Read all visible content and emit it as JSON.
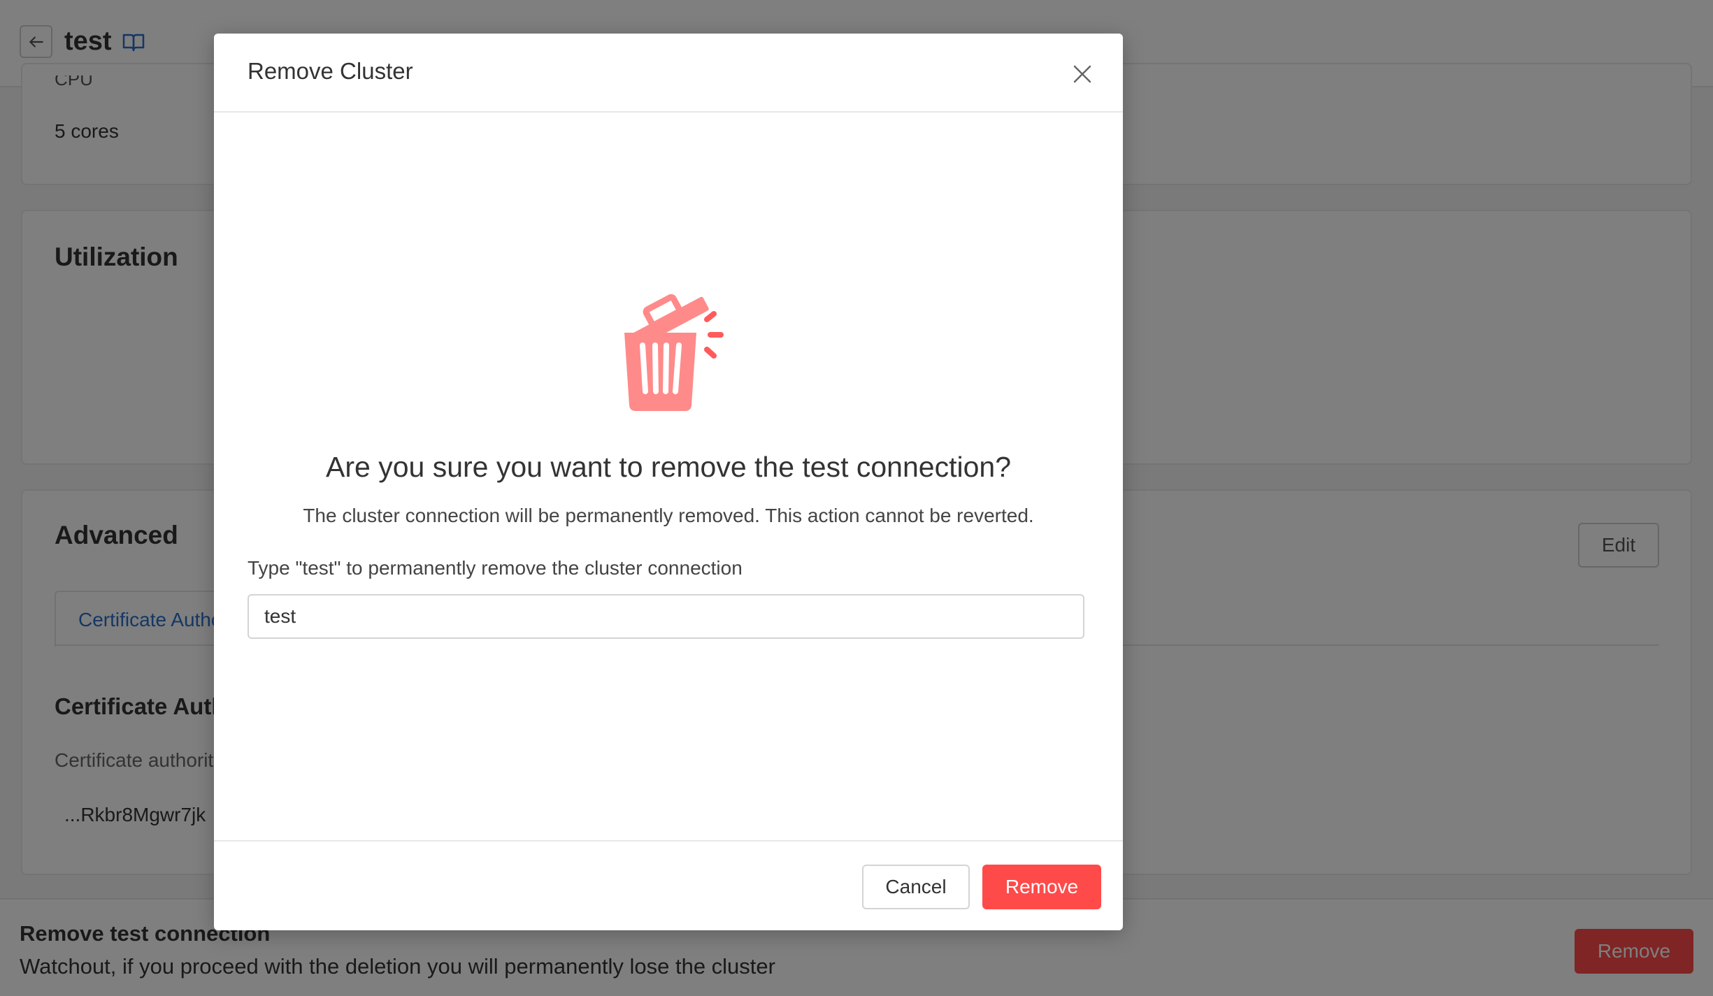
{
  "page": {
    "title": "test",
    "resources": {
      "cpu_label_partial": "CPU",
      "cpu_value": "5 cores"
    },
    "utilization": {
      "heading": "Utilization"
    },
    "advanced": {
      "heading": "Advanced",
      "edit_label": "Edit",
      "tab_label": "Certificate Authority",
      "cert_heading": "Certificate Authority",
      "cert_label": "Certificate authority",
      "cert_value": "...Rkbr8Mgwr7jk"
    },
    "danger_zone": {
      "title": "Remove test connection",
      "description": "Watchout, if you proceed with the deletion you will permanently lose the cluster",
      "button_label": "Remove"
    }
  },
  "modal": {
    "title": "Remove Cluster",
    "question": "Are you sure you want to remove the test connection?",
    "description": "The cluster connection will be permanently removed. This action cannot be reverted.",
    "confirm_label": "Type \"test\" to permanently remove the cluster connection",
    "confirm_value": "test",
    "cancel_label": "Cancel",
    "remove_label": "Remove",
    "icon": "trash-icon"
  },
  "colors": {
    "danger": "#ff4a4a",
    "trash_icon": "#ff8a8a",
    "link": "#2a6fc9",
    "overlay": "rgba(0,0,0,0.5)"
  }
}
